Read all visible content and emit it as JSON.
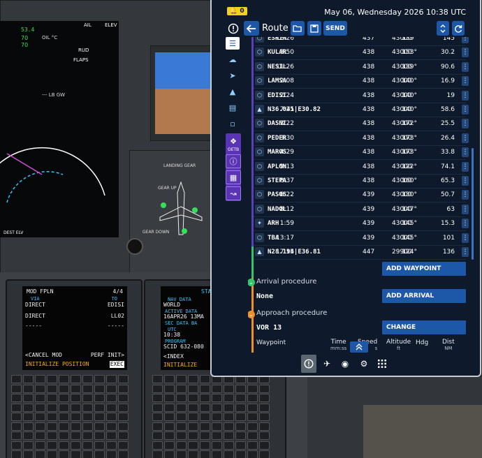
{
  "efb": {
    "notification_count": "0",
    "datetime": "May 06, Wednesday 2026 10:38 UTC",
    "page_title": "Route",
    "send_label": "SEND",
    "sidebar_oetb_label": "OETB",
    "waypoints": [
      {
        "ident": "ESKIN",
        "time": "18:26",
        "speed": "437",
        "alt": "43000",
        "hdg": "139°",
        "dist": "145",
        "icon": "waypoint-icon"
      },
      {
        "ident": "KULAR",
        "time": "3:50",
        "speed": "438",
        "alt": "43000",
        "hdg": "153°",
        "dist": "30.2",
        "icon": "waypoint-icon"
      },
      {
        "ident": "NESIL",
        "time": "11:26",
        "speed": "438",
        "alt": "43000",
        "hdg": "139°",
        "dist": "90.6",
        "icon": "waypoint-icon"
      },
      {
        "ident": "LAMSA",
        "time": "2:08",
        "speed": "438",
        "alt": "43000",
        "hdg": "140°",
        "dist": "16.9",
        "icon": "waypoint-icon"
      },
      {
        "ident": "EDISI",
        "time": "2:24",
        "speed": "438",
        "alt": "43000",
        "hdg": "140°",
        "dist": "19",
        "icon": "waypoint-icon"
      },
      {
        "ident": "N36.041|E30.82",
        "time": "7:25",
        "speed": "438",
        "alt": "43000",
        "hdg": "140°",
        "dist": "58.6",
        "icon": "coordinate-icon"
      },
      {
        "ident": "DASNI",
        "time": "3:22",
        "speed": "438",
        "alt": "43000",
        "hdg": "172°",
        "dist": "25.5",
        "icon": "waypoint-icon"
      },
      {
        "ident": "PEDER",
        "time": "3:30",
        "speed": "438",
        "alt": "43000",
        "hdg": "173°",
        "dist": "26.4",
        "icon": "waypoint-icon"
      },
      {
        "ident": "MAROS",
        "time": "4:29",
        "speed": "438",
        "alt": "43000",
        "hdg": "173°",
        "dist": "33.8",
        "icon": "waypoint-icon"
      },
      {
        "ident": "APLON",
        "time": "9:13",
        "speed": "438",
        "alt": "43000",
        "hdg": "122°",
        "dist": "74.1",
        "icon": "waypoint-icon"
      },
      {
        "ident": "STEPA",
        "time": "8:37",
        "speed": "438",
        "alt": "43000",
        "hdg": "160°",
        "dist": "65.3",
        "icon": "waypoint-icon"
      },
      {
        "ident": "PASOS",
        "time": "6:22",
        "speed": "439",
        "alt": "43000",
        "hdg": "130°",
        "dist": "50.7",
        "icon": "waypoint-icon"
      },
      {
        "ident": "NADOL",
        "time": "8:12",
        "speed": "439",
        "alt": "43000",
        "hdg": "147°",
        "dist": "63",
        "icon": "waypoint-icon"
      },
      {
        "ident": "ARH",
        "time": "1:59",
        "speed": "439",
        "alt": "43000",
        "hdg": "145°",
        "dist": "15.3",
        "icon": "vor-icon"
      },
      {
        "ident": "TBA",
        "time": "13:17",
        "speed": "439",
        "alt": "43000",
        "hdg": "145°",
        "dist": "101",
        "icon": "waypoint-icon"
      },
      {
        "ident": "N28.194|E36.81",
        "time": "17:15",
        "speed": "447",
        "alt": "29900",
        "hdg": "124°",
        "dist": "136",
        "icon": "coordinate-icon"
      }
    ],
    "add_waypoint_label": "ADD WAYPOINT",
    "arrival": {
      "label": "Arrival procedure",
      "value": "None",
      "button": "ADD ARRIVAL"
    },
    "approach": {
      "label": "Approach procedure",
      "value": "VOR 13",
      "button": "CHANGE"
    },
    "columns": {
      "waypoint": "Waypoint",
      "time": "Time",
      "time_unit": "mm:ss",
      "speed": "Speed",
      "speed_unit": "s",
      "altitude": "Altitude",
      "altitude_unit": "ft",
      "hdg": "Hdg",
      "dist": "Dist",
      "dist_unit": "NM"
    }
  },
  "mcdu_left": {
    "title": "MOD FPLN",
    "page": "4/4",
    "via_label": "VIA",
    "to_label": "TO",
    "line1_left": "DIRECT",
    "line1_right": "EDISI",
    "line2_left": "DIRECT",
    "line2_right": "LL02",
    "dashes": "-----",
    "cancel_mod": "<CANCEL MOD",
    "perf_init": "PERF INIT>",
    "init_position": "INITIALIZE POSITION",
    "exec": "EXEC"
  },
  "mcdu_right": {
    "title": "STA",
    "nav_data": "NAV DATA",
    "world": "WORLD",
    "active_data": "ACTIVE DATA",
    "active_date": "16APR26 13MA",
    "sec_data": "SEC DATA BA",
    "utc_label": "UTC",
    "utc_value": "10:38",
    "program_label": "PROGRAM",
    "program_value": "SCID 632-080",
    "index": "<INDEX",
    "initialize": "INITIALIZE"
  },
  "eicas": {
    "n2": "53.4",
    "oil_c": "70",
    "oil_psi": "70",
    "ail": "AIL",
    "elev": "ELEV",
    "rud": "RUD",
    "flaps": "FLAPS",
    "lb_gw": "--- LB GW",
    "dest_elv": "DEST ELV",
    "landing_gear": "LANDING GEAR",
    "gear_up": "GEAR UP",
    "gear_down": "GEAR DOWN"
  },
  "colors": {
    "efb_bg": "#0e1a2b",
    "accent": "#1d57a8",
    "arrival_dot": "#34c46a",
    "approach_dot": "#f0902a"
  }
}
